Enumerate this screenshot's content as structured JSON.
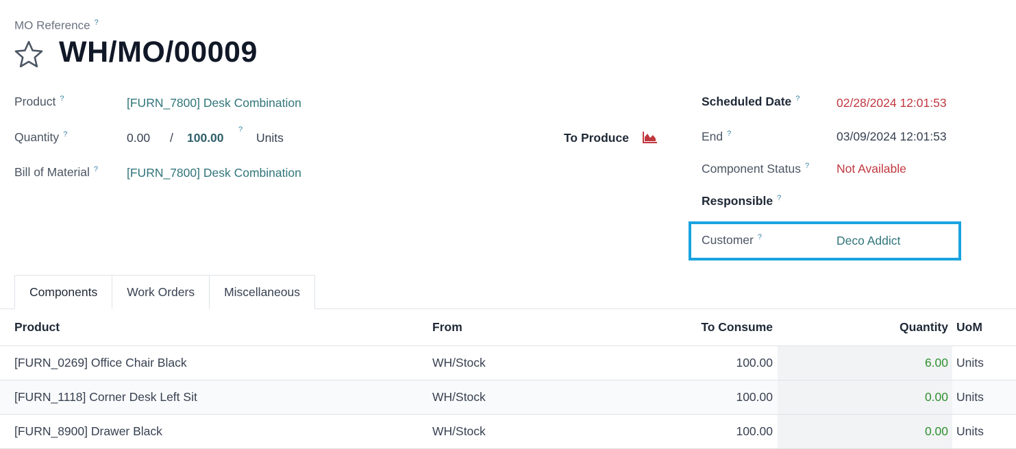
{
  "header": {
    "ref_label": "MO Reference",
    "help_mark": "?",
    "title": "WH/MO/00009"
  },
  "form": {
    "product_label": "Product",
    "product_value": "[FURN_7800] Desk Combination",
    "quantity_label": "Quantity",
    "quantity_done": "0.00",
    "quantity_sep": "/",
    "quantity_total": "100.00",
    "quantity_uom": "Units",
    "to_produce_label": "To Produce",
    "bom_label": "Bill of Material",
    "bom_value": "[FURN_7800] Desk Combination",
    "scheduled_label": "Scheduled Date",
    "scheduled_value": "02/28/2024 12:01:53",
    "end_label": "End",
    "end_value": "03/09/2024 12:01:53",
    "component_status_label": "Component Status",
    "component_status_value": "Not Available",
    "responsible_label": "Responsible",
    "customer_label": "Customer",
    "customer_value": "Deco Addict"
  },
  "tabs": [
    {
      "label": "Components"
    },
    {
      "label": "Work Orders"
    },
    {
      "label": "Miscellaneous"
    }
  ],
  "table": {
    "headers": {
      "product": "Product",
      "from": "From",
      "to_consume": "To Consume",
      "quantity": "Quantity",
      "uom": "UoM"
    },
    "rows": [
      {
        "product": "[FURN_0269] Office Chair Black",
        "from": "WH/Stock",
        "to_consume": "100.00",
        "quantity": "6.00",
        "uom": "Units"
      },
      {
        "product": "[FURN_1118] Corner Desk Left Sit",
        "from": "WH/Stock",
        "to_consume": "100.00",
        "quantity": "0.00",
        "uom": "Units"
      },
      {
        "product": "[FURN_8900] Drawer Black",
        "from": "WH/Stock",
        "to_consume": "100.00",
        "quantity": "0.00",
        "uom": "Units"
      }
    ]
  },
  "icons": {
    "favorite": "star-icon",
    "forecast": "area-chart-icon"
  },
  "colors": {
    "link": "#31757a",
    "danger": "#c0383f",
    "highlight": "#1aa3e0",
    "positive": "#2f8f2f"
  }
}
